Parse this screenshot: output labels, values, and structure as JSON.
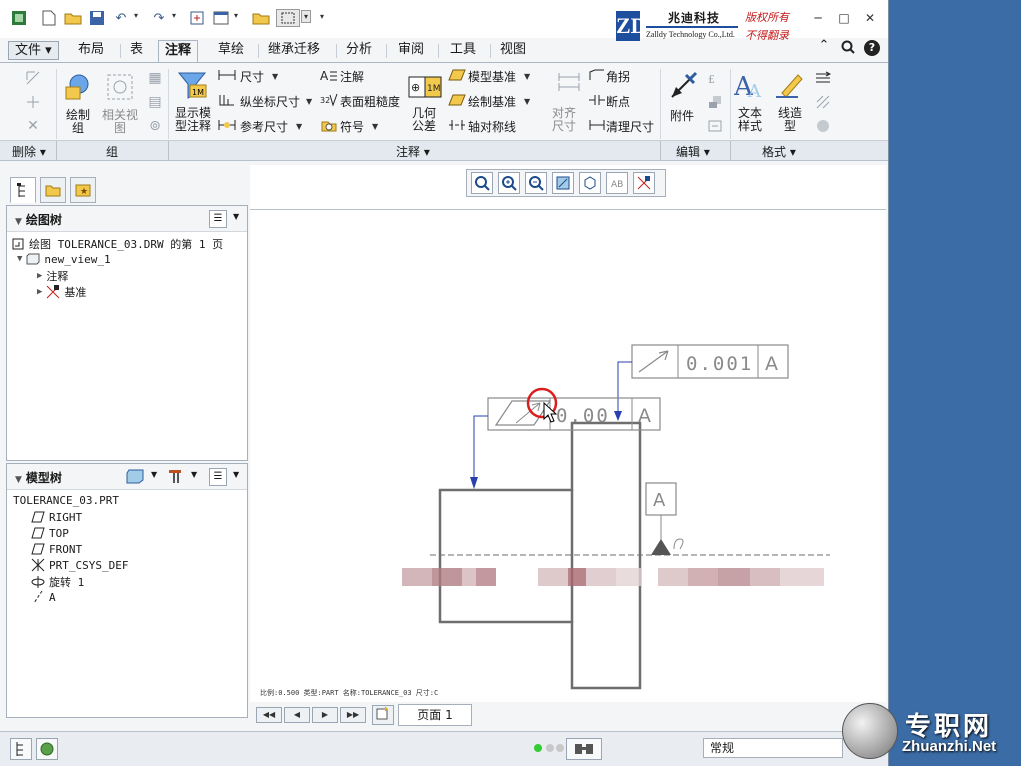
{
  "colors": {
    "accent": "#1d4f9e",
    "rights_red": "#c41a1a",
    "desktop": "#3b6ca5",
    "highlight_circle": "#d81e1e",
    "leader_blue": "#2a3fb0"
  },
  "branding": {
    "logo_letters": "ZD",
    "company_cn": "兆迪科技",
    "company_en": "Zalldy Technology Co.,Ltd.",
    "rights_line1": "版权所有",
    "rights_line2": "不得翻录"
  },
  "window_controls": {
    "minimize": "─",
    "restore": "□",
    "close": "✕"
  },
  "tabs": [
    {
      "label": "文件 ▾"
    },
    {
      "label": "布局"
    },
    {
      "label": "表"
    },
    {
      "label": "注释",
      "active": true
    },
    {
      "label": "草绘"
    },
    {
      "label": "继承迁移"
    },
    {
      "label": "分析"
    },
    {
      "label": "审阅"
    },
    {
      "label": "工具"
    },
    {
      "label": "视图"
    }
  ],
  "ribbon": {
    "draw_group": "绘制\n组",
    "related_view": "相关视\n图",
    "show_model_annotations": "显示模\n型注释",
    "dimension": "尺寸",
    "ordinate_dimension": "纵坐标尺寸",
    "reference_dimension": "参考尺寸",
    "note": "注解",
    "surface_finish": "表面粗糙度",
    "symbol": "符号",
    "geometric_tolerance": "几何\n公差",
    "model_datum": "模型基准",
    "draw_datum": "绘制基准",
    "axis_symmetry": "轴对称线",
    "align_dimension": "对齐\n尺寸",
    "corner": "角拐",
    "break": "断点",
    "cleanup_dimension": "清理尺寸",
    "attach": "附件",
    "text_style": "文本\n样式",
    "line_style": "线造\n型"
  },
  "groups": {
    "delete": "删除 ▾",
    "group": "组",
    "annotate": "注释 ▾",
    "edit": "编辑 ▾",
    "format": "格式 ▾"
  },
  "drawing_tree": {
    "title": "绘图树",
    "items": [
      {
        "label": "绘图 TOLERANCE_03.DRW 的第 1 页"
      },
      {
        "label": "new_view_1"
      },
      {
        "label": "注释"
      },
      {
        "label": "基准"
      }
    ]
  },
  "model_tree": {
    "title": "模型树",
    "items": [
      {
        "label": "TOLERANCE_03.PRT"
      },
      {
        "label": "RIGHT"
      },
      {
        "label": "TOP"
      },
      {
        "label": "FRONT"
      },
      {
        "label": "PRT_CSYS_DEF"
      },
      {
        "label": "旋转 1"
      },
      {
        "label": "A"
      }
    ]
  },
  "drawing": {
    "fcf_top_value": "0.001",
    "fcf_top_datum": "A",
    "fcf_mid_value": "0.00",
    "fcf_mid_datum": "A",
    "datum_label": "A",
    "status_line": "比例:0.500   类型:PART   名称:TOLERANCE_03   尺寸:C"
  },
  "page": {
    "tab_label": "页面 1"
  },
  "status": {
    "filter_value": "常规"
  },
  "watermark": {
    "cn": "专职网",
    "en": "Zhuanzhi.Net"
  }
}
